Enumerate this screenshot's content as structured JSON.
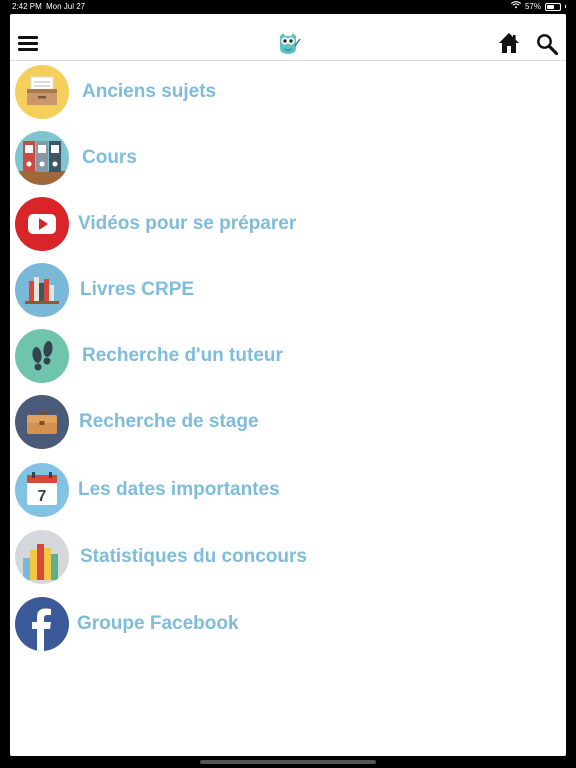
{
  "status_bar": {
    "time": "2:42 PM",
    "date": "Mon Jul 27",
    "battery": "57%",
    "battery_level": 0.57
  },
  "header": {
    "menu_icon": "hamburger-icon",
    "logo_icon": "owl-logo",
    "home_icon": "home-icon",
    "search_icon": "search-icon"
  },
  "menu": {
    "items": [
      {
        "label": "Anciens sujets",
        "icon": "archive-box-icon",
        "color": "#f5cf5b"
      },
      {
        "label": "Cours",
        "icon": "binders-icon",
        "color": "#7fc4cf"
      },
      {
        "label": "Vidéos pour se préparer",
        "icon": "youtube-icon",
        "color": "#d9252a"
      },
      {
        "label": "Livres CRPE",
        "icon": "books-icon",
        "color": "#7ab8d8"
      },
      {
        "label": "Recherche d'un tuteur",
        "icon": "footprints-icon",
        "color": "#6fc4ac"
      },
      {
        "label": "Recherche de stage",
        "icon": "briefcase-icon",
        "color": "#4a5a78"
      },
      {
        "label": "Les dates importantes",
        "icon": "calendar-icon",
        "color": "#82c3e3"
      },
      {
        "label": "Statistiques du concours",
        "icon": "statistics-icon",
        "color": "#d4d8dc"
      },
      {
        "label": "Groupe Facebook",
        "icon": "facebook-icon",
        "color": "#3b5998"
      }
    ]
  },
  "calendar_day": "7",
  "label_color": "#7fbcdb"
}
